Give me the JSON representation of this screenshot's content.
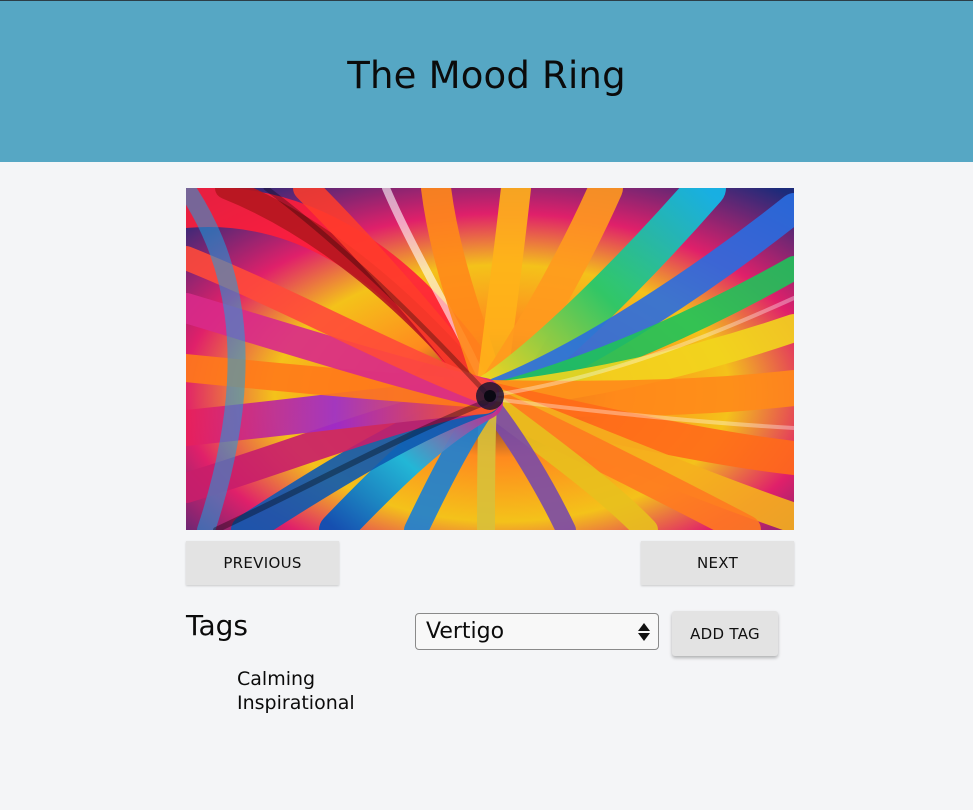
{
  "header": {
    "title": "The Mood Ring",
    "background_color": "#56a7c4"
  },
  "artwork": {
    "description_icon": "colorful-swirl-image"
  },
  "navigation": {
    "previous_label": "PREVIOUS",
    "next_label": "NEXT"
  },
  "tags": {
    "heading": "Tags",
    "selected_tag": "Vertigo",
    "add_label": "ADD TAG",
    "items": [
      "Calming",
      "Inspirational"
    ]
  }
}
